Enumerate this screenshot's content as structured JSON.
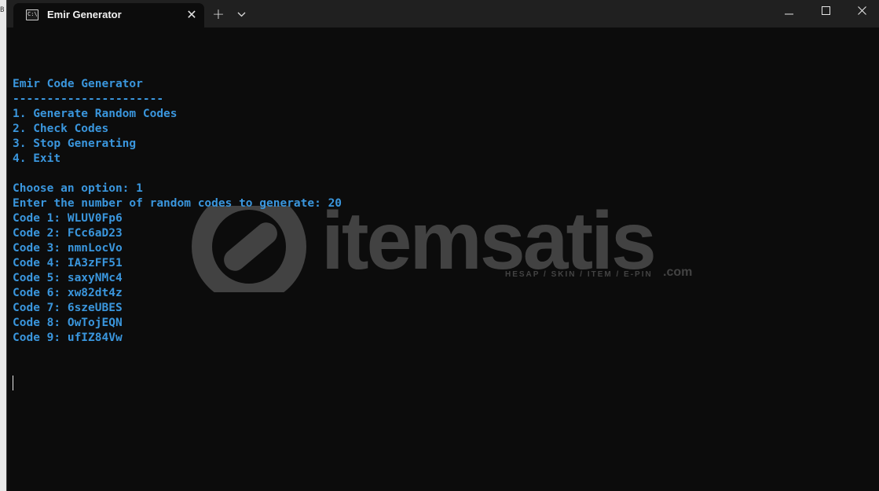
{
  "window": {
    "tab_title": "Emir Generator",
    "tab_icon_text": "C:\\",
    "new_tab_symbol": "+",
    "dropdown_symbol": "⌄",
    "close_symbol": "✕",
    "minimize_symbol": "—",
    "window_close_symbol": "✕"
  },
  "terminal": {
    "lines": [
      "Emir Code Generator",
      "----------------------",
      "1. Generate Random Codes",
      "2. Check Codes",
      "3. Stop Generating",
      "4. Exit",
      "",
      "Choose an option: 1",
      "Enter the number of random codes to generate: 20",
      "Code 1: WLUV0Fp6",
      "Code 2: FCc6aD23",
      "Code 3: nmnLocVo",
      "Code 4: IA3zFF51",
      "Code 5: saxyNMc4",
      "Code 6: xw82dt4z",
      "Code 7: 6szeUBES",
      "Code 8: OwTojEQN",
      "Code 9: ufIZ84Vw"
    ],
    "text_color": "#3a96dd",
    "background": "#0c0c0c"
  },
  "watermark": {
    "brand": "itemsatis",
    "tagline": "HESAP / SKIN / ITEM / E-PIN",
    "suffix": ".com"
  },
  "edge_fragment": "B"
}
